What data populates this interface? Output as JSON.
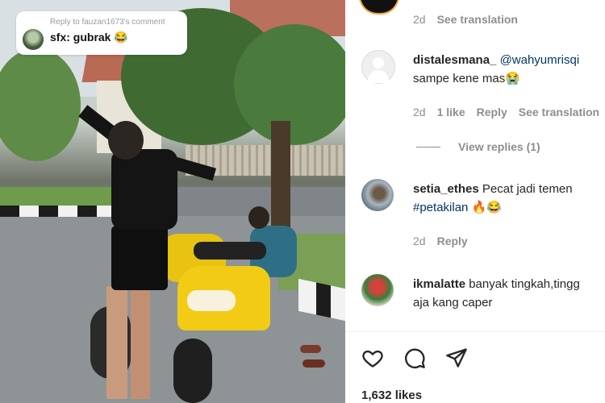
{
  "video": {
    "sticker": {
      "reply_to": "Reply to fauzan1673's comment",
      "message": "sfx: gubrak",
      "emoji": "😂"
    }
  },
  "comments_panel": {
    "top_meta": {
      "time": "2d",
      "see_translation": "See translation"
    },
    "comments": [
      {
        "username": "distalesmana_",
        "mention": "@wahyumrisqi",
        "text": "sampe kene mas",
        "emoji": "😭",
        "avatar": "default-avatar-icon",
        "time": "2d",
        "likes": "1 like",
        "reply": "Reply",
        "see_translation": "See translation",
        "view_replies": "View replies (1)"
      },
      {
        "username": "setia_ethes",
        "text": "Pecat jadi temen",
        "hashtag": "#petakilan",
        "emoji": "🔥😂",
        "time": "2d",
        "reply": "Reply"
      },
      {
        "username": "ikmalatte",
        "text_line1": "banyak tingkah,tingg",
        "text_line2": "aja kang caper"
      }
    ],
    "actions": {
      "like_icon": "heart-icon",
      "comment_icon": "comment-bubble-icon",
      "share_icon": "send-icon"
    },
    "likes_count": "1,632 likes"
  },
  "colors": {
    "link_blue": "#00376b",
    "meta_gray": "#8e8e8e",
    "text": "#262626"
  }
}
